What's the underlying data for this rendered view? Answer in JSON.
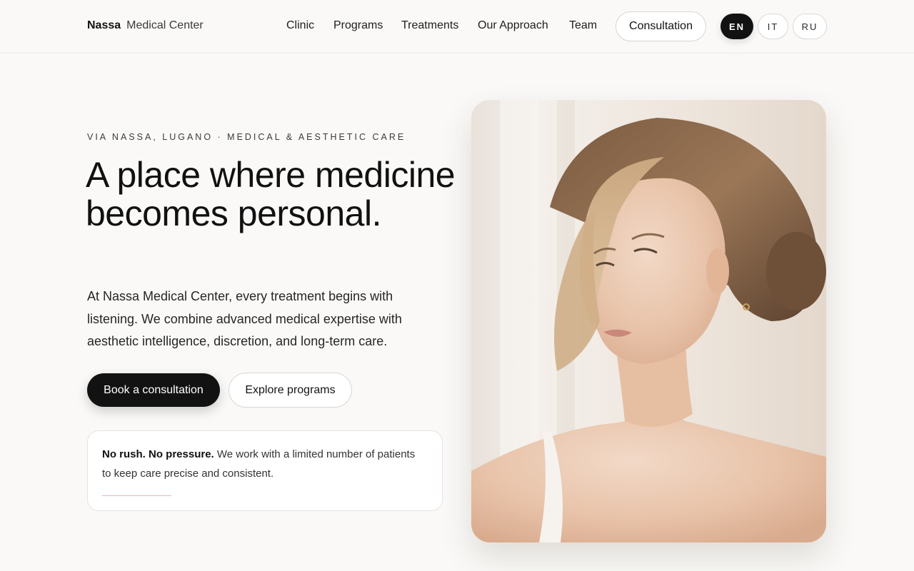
{
  "brand": {
    "name": "Nassa",
    "subtitle": "Medical Center"
  },
  "nav": {
    "items": [
      "Clinic",
      "Programs",
      "Treatments",
      "Our Approach",
      "Team"
    ],
    "cta_label": "Consultation"
  },
  "languages": [
    {
      "code": "EN",
      "active": true
    },
    {
      "code": "IT",
      "active": false
    },
    {
      "code": "RU",
      "active": false
    }
  ],
  "hero": {
    "eyebrow": "VIA NASSA, LUGANO · MEDICAL & AESTHETIC CARE",
    "headline": "A place where medicine becomes personal.",
    "lead": "At Nassa Medical Center, every treatment begins with listening. We combine advanced medical expertise with aesthetic intelligence, discretion, and long-term care.",
    "primary_button": "Book a consultation",
    "secondary_button": "Explore programs"
  },
  "note": {
    "bold": "No rush. No pressure.",
    "text": " We work with a limited number of patients to keep care precise and consistent."
  },
  "image": {
    "subject": "portrait-of-woman"
  },
  "colors": {
    "primary": "#121212",
    "background": "#faf9f7",
    "accent_line": "#e8b7b7"
  }
}
